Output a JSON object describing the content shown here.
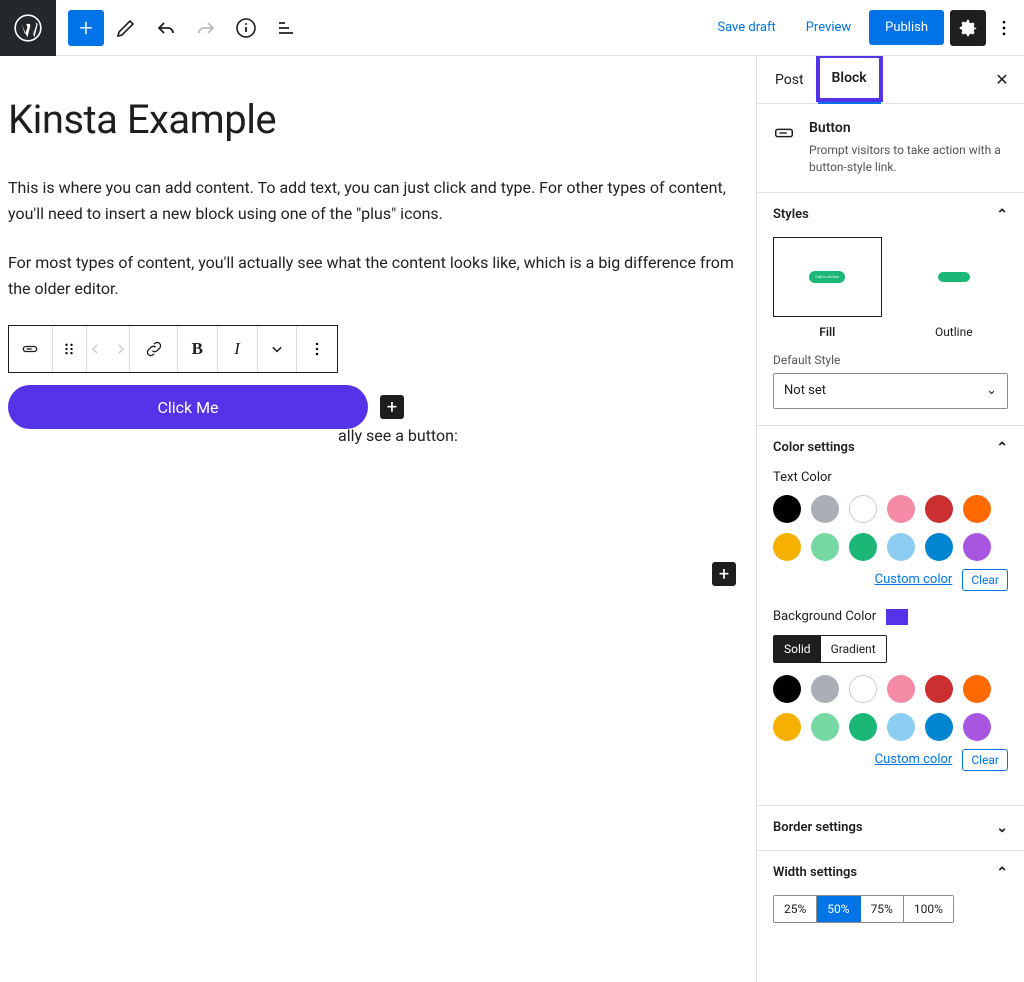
{
  "topbar": {
    "saveDraft": "Save draft",
    "preview": "Preview",
    "publish": "Publish"
  },
  "post": {
    "title": "Kinsta Example",
    "para1": "This is where you can add content. To add text, you can just click and type. For other types of content, you'll need to insert a new block using one of the \"plus\" icons.",
    "para2": "For most types of content, you'll actually see what the content looks like, which is a big difference from the older editor.",
    "behind": "ally see a button:",
    "buttonLabel": "Click Me"
  },
  "sidebar": {
    "tabs": {
      "post": "Post",
      "block": "Block"
    },
    "summary": {
      "title": "Button",
      "desc": "Prompt visitors to take action with a button-style link."
    },
    "styles": {
      "header": "Styles",
      "fill": "Fill",
      "outline": "Outline",
      "defaultStyleLabel": "Default Style",
      "defaultStyleValue": "Not set"
    },
    "colorSettings": {
      "header": "Color settings",
      "textColor": "Text Color",
      "backgroundColor": "Background Color",
      "solid": "Solid",
      "gradient": "Gradient",
      "customColor": "Custom color",
      "clear": "Clear"
    },
    "borderSettings": {
      "header": "Border settings"
    },
    "widthSettings": {
      "header": "Width settings",
      "options": {
        "w25": "25%",
        "w50": "50%",
        "w75": "75%",
        "w100": "100%"
      }
    }
  },
  "colors": {
    "palette": [
      "#000000",
      "#a9afb5",
      "#ffffff",
      "#f58ba6",
      "#cc2f30",
      "#ff6a00",
      "#f6b100",
      "#76d9a3",
      "#1bb776",
      "#8dcdf1",
      "#0085d1",
      "#a856e0"
    ],
    "accent": "#5533E8"
  }
}
